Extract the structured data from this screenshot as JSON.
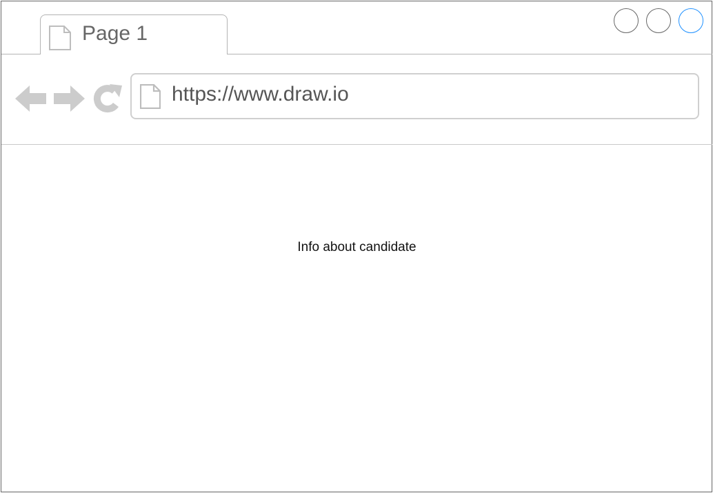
{
  "tab": {
    "label": "Page 1"
  },
  "address_bar": {
    "url": "https://www.draw.io"
  },
  "content": {
    "text": "Info about candidate"
  },
  "colors": {
    "border": "#666666",
    "light_gray": "#cccccc",
    "accent": "#1e90ff"
  },
  "icons": [
    "page-icon",
    "back-arrow-icon",
    "forward-arrow-icon",
    "reload-icon",
    "window-control-icon"
  ]
}
